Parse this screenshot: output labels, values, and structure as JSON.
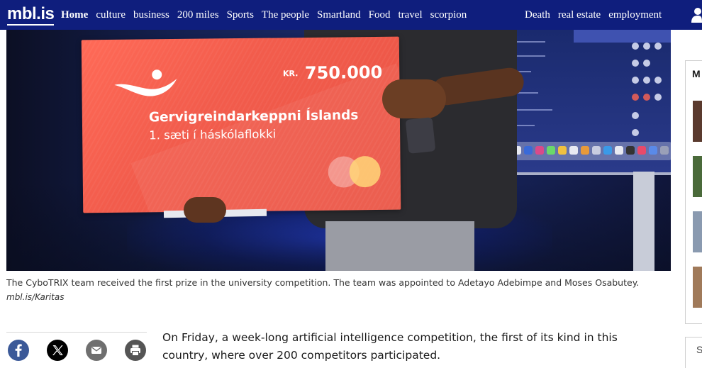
{
  "brand": {
    "logo_text": "mbl.is",
    "nav_color": "#0f1e7d"
  },
  "nav": {
    "left_items": [
      "Home",
      "culture",
      "business",
      "200 miles",
      "Sports",
      "The people",
      "Smartland",
      "Food",
      "travel",
      "scorpion"
    ],
    "right_items": [
      "Death",
      "real estate",
      "employment"
    ],
    "active": "Home"
  },
  "hero_image": {
    "check": {
      "currency": "KR.",
      "amount": "750.000",
      "title": "Gervigreindarkeppni Íslands",
      "subtitle": "1. sæti í háskólaflokki",
      "color": "#f25c4c"
    }
  },
  "caption": {
    "text": "The CyboTRIX team received the first prize in the university competition. The team was appointed to Adetayo Adebimpe and Moses Osabutey.",
    "credit": "mbl.is/Karitas"
  },
  "share": {
    "buttons": [
      {
        "name": "facebook-icon",
        "color": "#3b5998"
      },
      {
        "name": "x-icon",
        "color": "#000000"
      },
      {
        "name": "email-icon",
        "color": "#6f6f6f"
      },
      {
        "name": "print-icon",
        "color": "#555555"
      }
    ]
  },
  "article": {
    "lead": "On Friday, a week-long artificial intelligence competition, the first of its kind in this country, where over 200 competitors participated."
  },
  "sidebar": {
    "heading_letter": "M",
    "bottom_letter": "S"
  }
}
